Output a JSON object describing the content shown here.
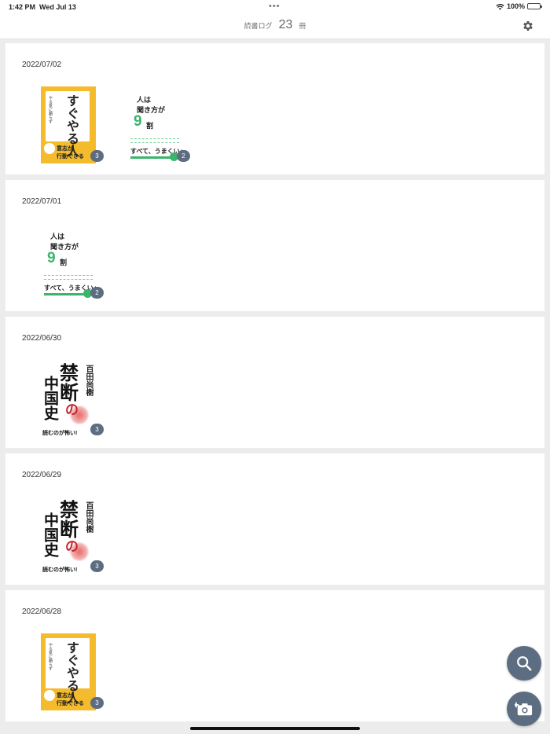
{
  "status_bar": {
    "time": "1:42 PM",
    "date": "Wed Jul 13",
    "battery": "100%"
  },
  "header": {
    "label": "読書ログ",
    "count": "23",
    "unit": "冊"
  },
  "covers": {
    "yellow": {
      "big": "すぐやる人",
      "small": "やる気に頼らず",
      "sub1": "意志が",
      "sub2": "行動できる"
    },
    "white": {
      "t1": "人は",
      "t2": "聞き方が",
      "nine": "9",
      "wari": "割",
      "t3": "すべて、うまくいく"
    },
    "red": {
      "k1": "禁",
      "k2": "断",
      "no": "の",
      "k3": "中国史",
      "author": "百田尚樹",
      "bottom": "読むのが怖い!"
    }
  },
  "entries": [
    {
      "date": "2022/07/02",
      "books": [
        {
          "cover": "yellow",
          "count": "3"
        },
        {
          "cover": "white",
          "count": "2"
        }
      ]
    },
    {
      "date": "2022/07/01",
      "books": [
        {
          "cover": "white",
          "count": "2"
        }
      ]
    },
    {
      "date": "2022/06/30",
      "books": [
        {
          "cover": "red",
          "count": "3"
        }
      ]
    },
    {
      "date": "2022/06/29",
      "books": [
        {
          "cover": "red",
          "count": "3"
        }
      ]
    },
    {
      "date": "2022/06/28",
      "books": [
        {
          "cover": "yellow",
          "count": "3"
        }
      ]
    }
  ],
  "icons": {
    "settings": "gear-icon",
    "search": "search-icon",
    "camera": "camera-add-icon",
    "wifi": "wifi-icon"
  },
  "colors": {
    "accent": "#5d6d81",
    "background": "#ececec",
    "green": "#3bb56c",
    "yellow": "#f4bb2d",
    "red": "#c0282f"
  }
}
